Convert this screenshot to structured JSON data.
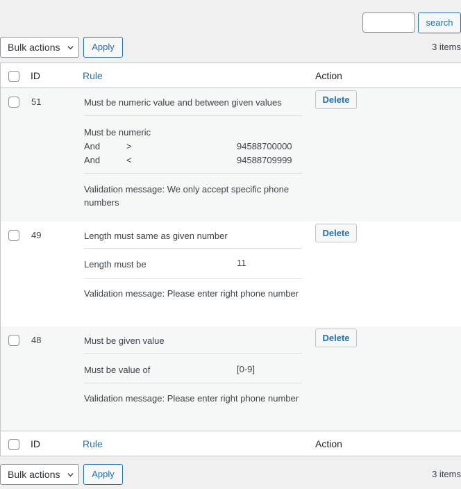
{
  "search": {
    "value": "",
    "button_label": "search"
  },
  "bulk_actions": {
    "selected": "Bulk actions",
    "apply_label": "Apply"
  },
  "items_count": "3 items",
  "columns": {
    "id": "ID",
    "rule": "Rule",
    "action": "Action"
  },
  "rows": [
    {
      "id": "51",
      "title": "Must be numeric value and between given values",
      "line1": "Must be numeric",
      "cond1_op": "And",
      "cond1_sym": ">",
      "cond1_val": "94588700000",
      "cond2_op": "And",
      "cond2_sym": "<",
      "cond2_val": "94588709999",
      "message": "Validation message: We only accept specific phone numbers",
      "delete_label": "Delete"
    },
    {
      "id": "49",
      "title": "Length must same as given number",
      "line1": "Length must be",
      "value": "11",
      "message": "Validation message: Please enter right phone number",
      "delete_label": "Delete"
    },
    {
      "id": "48",
      "title": "Must be given value",
      "line1": "Must be value of",
      "value": "[0-9]",
      "message": "Validation message: Please enter right phone number",
      "delete_label": "Delete"
    }
  ]
}
